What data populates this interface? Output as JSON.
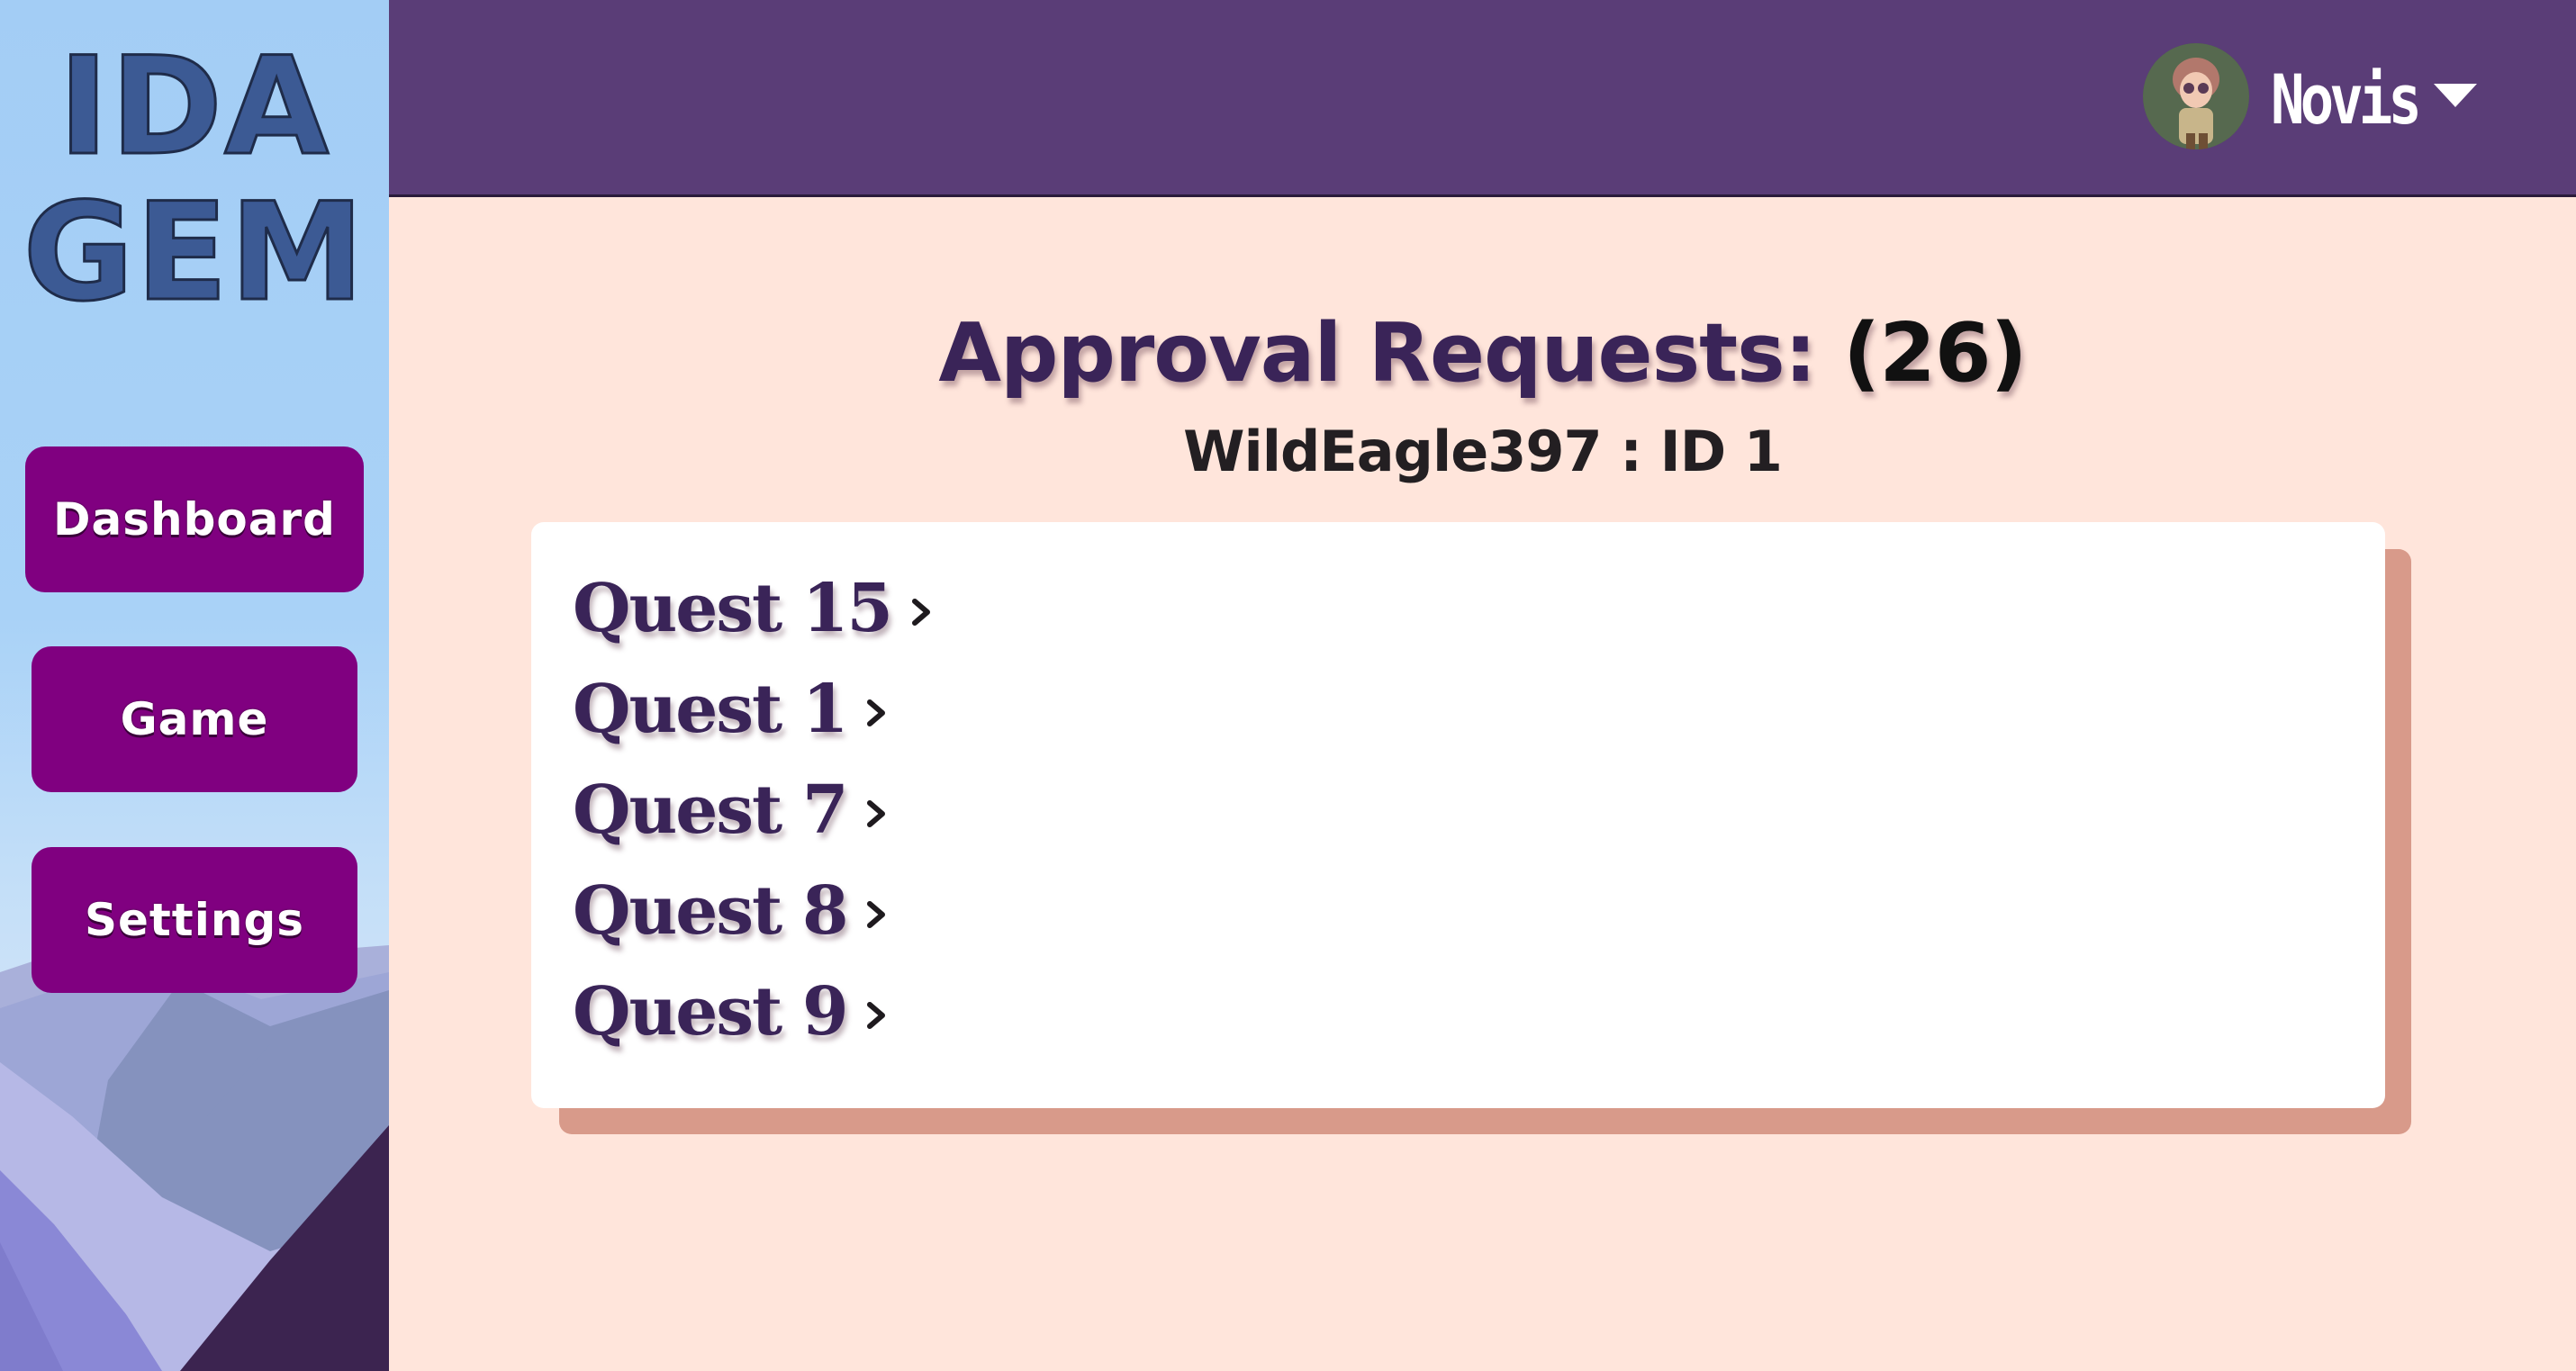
{
  "sidebar": {
    "logo_line1": "IDA",
    "logo_line2": "GEM",
    "items": [
      {
        "label": "Dashboard"
      },
      {
        "label": "Game"
      },
      {
        "label": "Settings"
      }
    ]
  },
  "header": {
    "user_name": "Novis",
    "avatar_icon": "user-avatar",
    "menu_icon": "caret-down-icon",
    "background_color": "#5A3D77"
  },
  "main": {
    "title_text": "Approval Requests:",
    "title_count": "(26)",
    "subtitle": "WildEagle397 : ID 1",
    "quests": [
      {
        "label": "Quest 15"
      },
      {
        "label": "Quest 1"
      },
      {
        "label": "Quest 7"
      },
      {
        "label": "Quest 8"
      },
      {
        "label": "Quest 9"
      }
    ],
    "item_icon": "chevron-right-icon"
  },
  "colors": {
    "page_background": "#FFE5DB",
    "nav_button": "#800080",
    "title_text": "#3A2458",
    "card_shadow": "#D89A8A",
    "logo": "#3C5A94"
  }
}
